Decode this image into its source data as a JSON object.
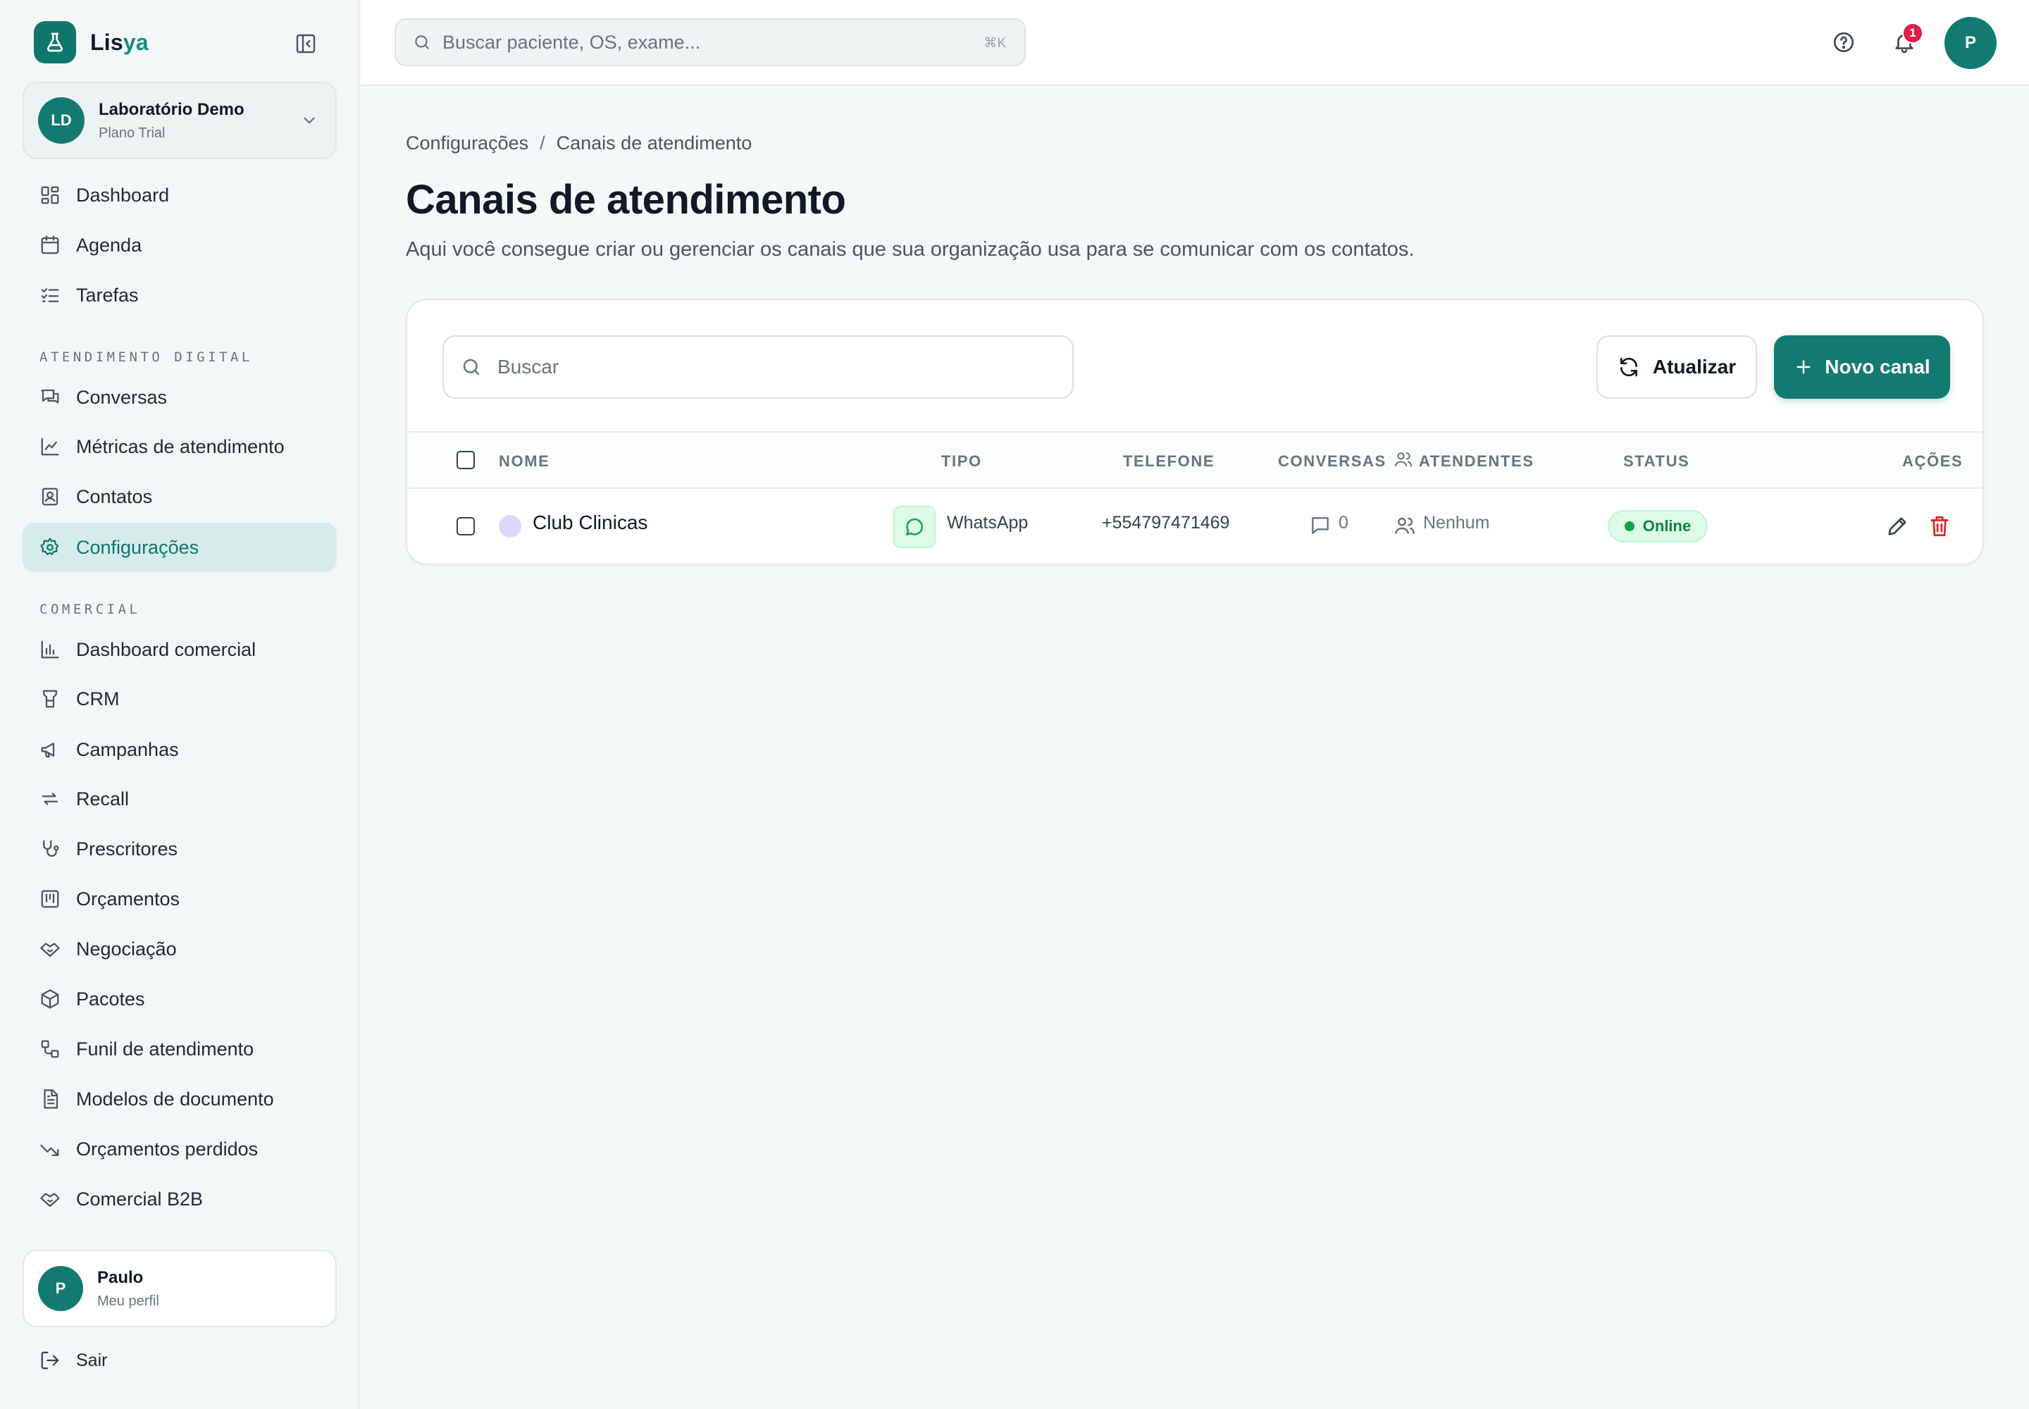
{
  "brand": {
    "name_prefix": "Lis",
    "name_suffix": "ya",
    "accent_color": "#137a72"
  },
  "org": {
    "initials": "LD",
    "name": "Laboratório Demo",
    "plan": "Plano Trial"
  },
  "nav_main": [
    {
      "label": "Dashboard",
      "icon": "dashboard-icon"
    },
    {
      "label": "Agenda",
      "icon": "calendar-icon"
    },
    {
      "label": "Tarefas",
      "icon": "tasks-icon"
    }
  ],
  "section_digital": "ATENDIMENTO DIGITAL",
  "nav_digital": [
    {
      "label": "Conversas",
      "icon": "chat-icon"
    },
    {
      "label": "Métricas de atendimento",
      "icon": "metrics-icon"
    },
    {
      "label": "Contatos",
      "icon": "contacts-icon"
    },
    {
      "label": "Configurações",
      "icon": "gear-icon",
      "active": true
    }
  ],
  "section_comercial": "COMERCIAL",
  "nav_comercial": [
    {
      "label": "Dashboard comercial",
      "icon": "bar-chart-icon"
    },
    {
      "label": "CRM",
      "icon": "crm-icon"
    },
    {
      "label": "Campanhas",
      "icon": "megaphone-icon"
    },
    {
      "label": "Recall",
      "icon": "recall-icon"
    },
    {
      "label": "Prescritores",
      "icon": "stethoscope-icon"
    },
    {
      "label": "Orçamentos",
      "icon": "kanban-icon"
    },
    {
      "label": "Negociação",
      "icon": "handshake-icon"
    },
    {
      "label": "Pacotes",
      "icon": "package-icon"
    },
    {
      "label": "Funil de atendimento",
      "icon": "funnel-icon"
    },
    {
      "label": "Modelos de documento",
      "icon": "document-icon"
    },
    {
      "label": "Orçamentos perdidos",
      "icon": "trending-down-icon"
    },
    {
      "label": "Comercial B2B",
      "icon": "handshake-icon"
    }
  ],
  "user": {
    "initial": "P",
    "name": "Paulo",
    "subtitle": "Meu perfil"
  },
  "logout_label": "Sair",
  "topbar": {
    "search_placeholder": "Buscar paciente, OS, exame...",
    "shortcut": "⌘K",
    "notification_count": "1",
    "avatar_initial": "P"
  },
  "breadcrumb": {
    "parent": "Configurações",
    "separator": "/",
    "current": "Canais de atendimento"
  },
  "page": {
    "title": "Canais de atendimento",
    "description": "Aqui você consegue criar ou gerenciar os canais que sua organização usa para se comunicar com os contatos."
  },
  "toolbar": {
    "search_placeholder": "Buscar",
    "refresh_label": "Atualizar",
    "new_label": "Novo canal"
  },
  "table": {
    "headers": {
      "nome": "NOME",
      "tipo": "TIPO",
      "telefone": "TELEFONE",
      "conversas": "CONVERSAS",
      "atendentes": "ATENDENTES",
      "status": "STATUS",
      "acoes": "AÇÕES"
    },
    "rows": [
      {
        "nome": "Club Clinicas",
        "tipo": "WhatsApp",
        "telefone": "+554797471469",
        "conversas": "0",
        "atendentes": "Nenhum",
        "status": "Online"
      }
    ]
  }
}
